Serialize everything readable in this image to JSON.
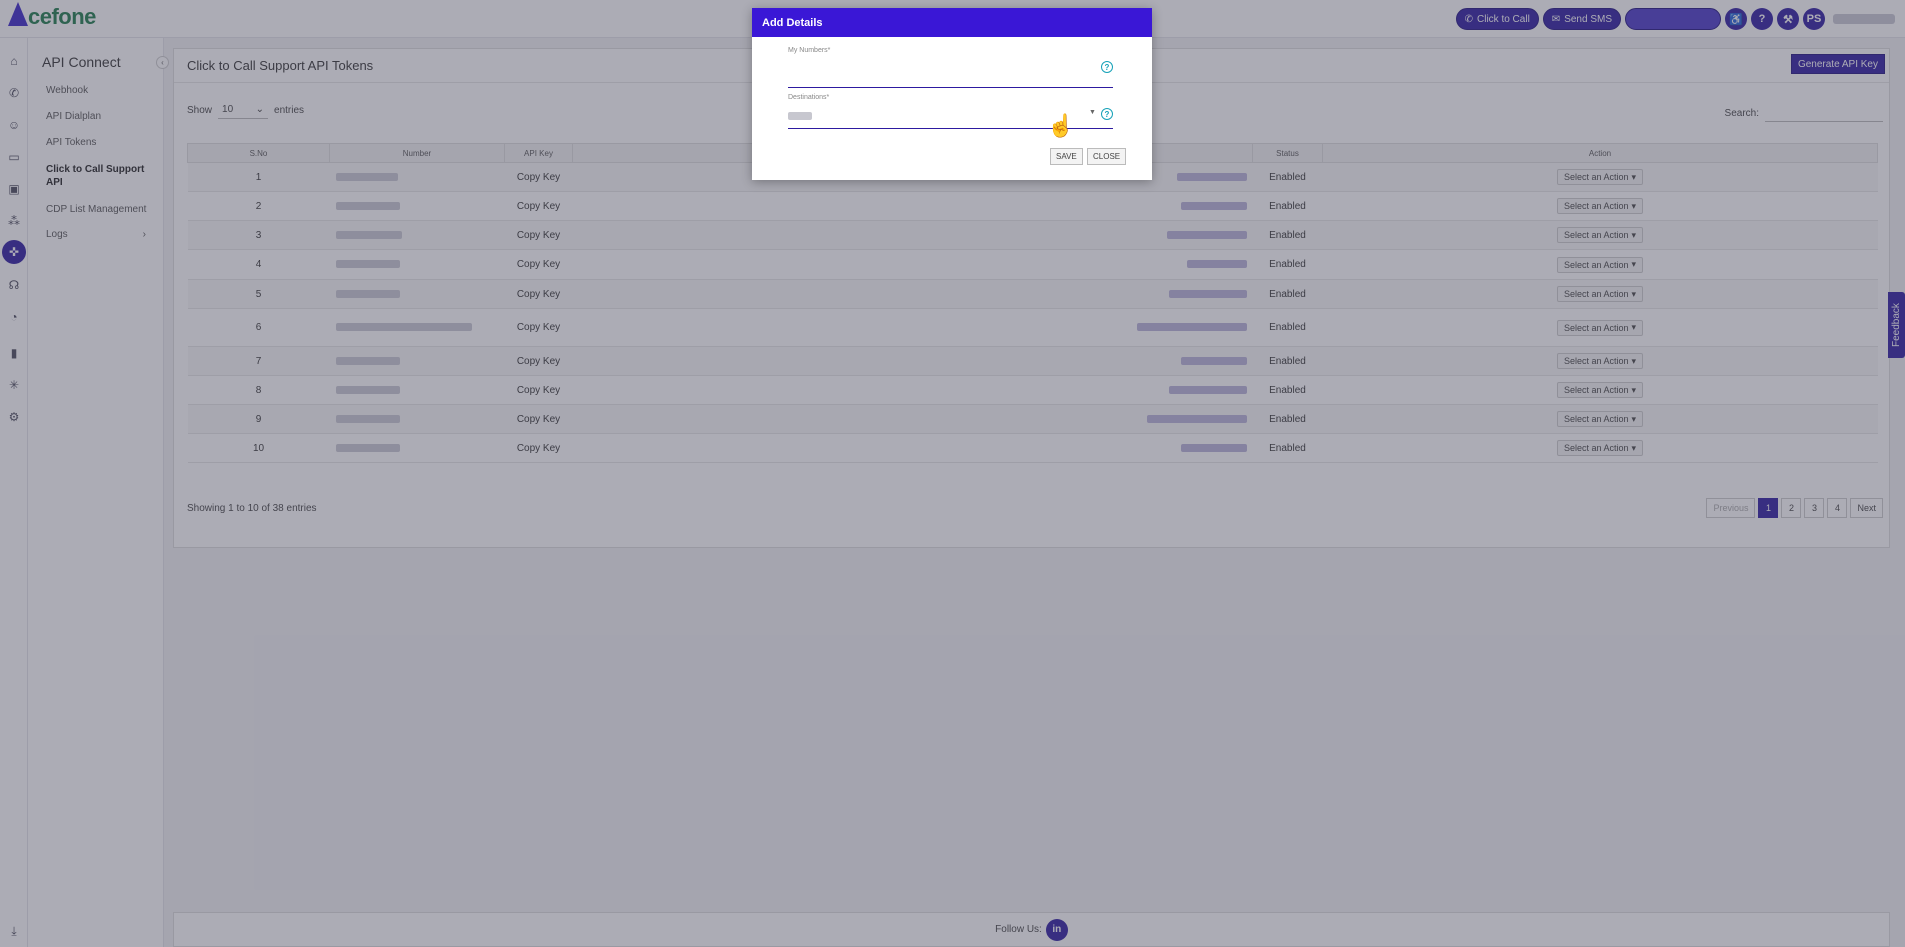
{
  "topbar": {
    "logo": "Acefone",
    "click_to_call": "Click to Call",
    "send_sms": "Send SMS",
    "user_initials": "PS",
    "help": "?"
  },
  "rail_icons": [
    "home-icon",
    "phone-icon",
    "users-icon",
    "wallet-icon",
    "monitor-icon",
    "network-icon",
    "api-icon",
    "ear-icon",
    "timer-icon",
    "bar-chart-icon",
    "hub-icon",
    "settings-icon",
    "download-icon"
  ],
  "submenu": {
    "title": "API Connect",
    "items": [
      "Webhook",
      "API Dialplan",
      "API Tokens",
      "Click to Call Support API",
      "CDP List Management",
      "Logs"
    ]
  },
  "page": {
    "title": "Click to Call Support API Tokens",
    "generate_label": "Generate API Key",
    "show_label": "Show",
    "entries_value": "10",
    "entries_label": "entries",
    "search_label": "Search:",
    "showing": "Showing 1 to 10 of 38 entries"
  },
  "table": {
    "headers": [
      "S.No",
      "Number",
      "API Key",
      "",
      "Status",
      "Action"
    ],
    "rows": [
      {
        "sno": "1",
        "api_key": "Copy Key",
        "status": "Enabled",
        "action": "Select an Action"
      },
      {
        "sno": "2",
        "api_key": "Copy Key",
        "status": "Enabled",
        "action": "Select an Action"
      },
      {
        "sno": "3",
        "api_key": "Copy Key",
        "status": "Enabled",
        "action": "Select an Action"
      },
      {
        "sno": "4",
        "api_key": "Copy Key",
        "status": "Enabled",
        "action": "Select an Action"
      },
      {
        "sno": "5",
        "api_key": "Copy Key",
        "status": "Enabled",
        "action": "Select an Action"
      },
      {
        "sno": "6",
        "api_key": "Copy Key",
        "status": "Enabled",
        "action": "Select an Action"
      },
      {
        "sno": "7",
        "api_key": "Copy Key",
        "status": "Enabled",
        "action": "Select an Action"
      },
      {
        "sno": "8",
        "api_key": "Copy Key",
        "status": "Enabled",
        "action": "Select an Action"
      },
      {
        "sno": "9",
        "api_key": "Copy Key",
        "status": "Enabled",
        "action": "Select an Action"
      },
      {
        "sno": "10",
        "api_key": "Copy Key",
        "status": "Enabled",
        "action": "Select an Action"
      }
    ]
  },
  "pagination": {
    "previous": "Previous",
    "pages": [
      "1",
      "2",
      "3",
      "4"
    ],
    "next": "Next"
  },
  "footer": {
    "follow": "Follow Us:",
    "linkedin": "in"
  },
  "feedback": "Feedback",
  "modal": {
    "title": "Add Details",
    "my_numbers_label": "My Numbers*",
    "destinations_label": "Destinations*",
    "save": "SAVE",
    "close": "CLOSE"
  },
  "colors": {
    "brand": "#2d1aa0",
    "modal_header": "#3a17d6",
    "help": "#17a2b8"
  }
}
